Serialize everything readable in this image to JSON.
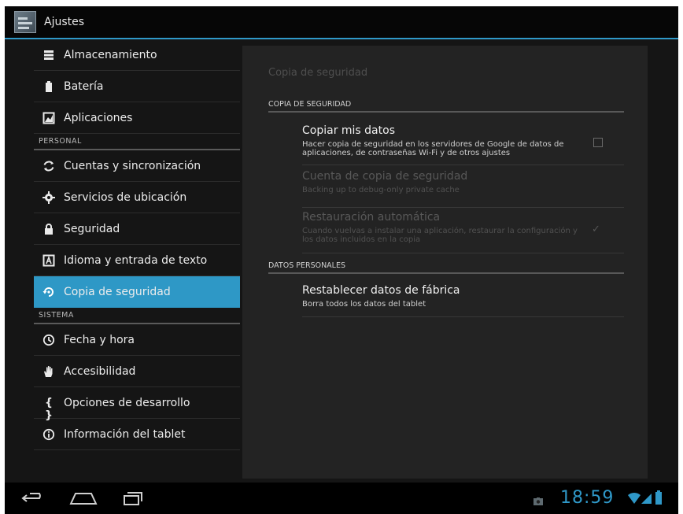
{
  "app": {
    "title": "Ajustes"
  },
  "colors": {
    "accent": "#2e98c6",
    "background": "#151515",
    "panel": "#232323",
    "text": "#ececec"
  },
  "sidebar": {
    "items": [
      {
        "label": "Almacenamiento",
        "icon": "storage-icon"
      },
      {
        "label": "Batería",
        "icon": "battery-icon"
      },
      {
        "label": "Aplicaciones",
        "icon": "apps-icon"
      },
      {
        "header": "PERSONAL"
      },
      {
        "label": "Cuentas y sincronización",
        "icon": "sync-icon"
      },
      {
        "label": "Servicios de ubicación",
        "icon": "location-icon"
      },
      {
        "label": "Seguridad",
        "icon": "lock-icon"
      },
      {
        "label": "Idioma y entrada de texto",
        "icon": "language-icon"
      },
      {
        "label": "Copia de seguridad",
        "icon": "backup-icon",
        "selected": true
      },
      {
        "header": "SISTEMA"
      },
      {
        "label": "Fecha y hora",
        "icon": "clock-icon"
      },
      {
        "label": "Accesibilidad",
        "icon": "hand-icon"
      },
      {
        "label": "Opciones de desarrollo",
        "icon": "braces-icon"
      },
      {
        "label": "Información del tablet",
        "icon": "info-icon"
      }
    ]
  },
  "detail": {
    "title": "Copia de seguridad",
    "sections": [
      {
        "header": "COPIA DE SEGURIDAD"
      },
      {
        "header": "DATOS PERSONALES"
      }
    ],
    "prefs": [
      {
        "title": "Copiar mis datos",
        "summary": "Hacer copia de seguridad en los servidores de Google de datos de aplicaciones, de contraseñas Wi-Fi y de otros ajustes",
        "enabled": true,
        "widget": "checkbox",
        "checked": false
      },
      {
        "title": "Cuenta de copia de seguridad",
        "summary": "Backing up to debug-only private cache",
        "enabled": false
      },
      {
        "title": "Restauración automática",
        "summary": "Cuando vuelvas a instalar una aplicación, restaurar la configuración y los datos incluidos en la copia",
        "enabled": false,
        "widget": "checkbox",
        "checked": true
      },
      {
        "title": "Restablecer datos de fábrica",
        "summary": "Borra todos los datos del tablet",
        "enabled": true
      }
    ]
  },
  "status": {
    "time": "18:59"
  }
}
